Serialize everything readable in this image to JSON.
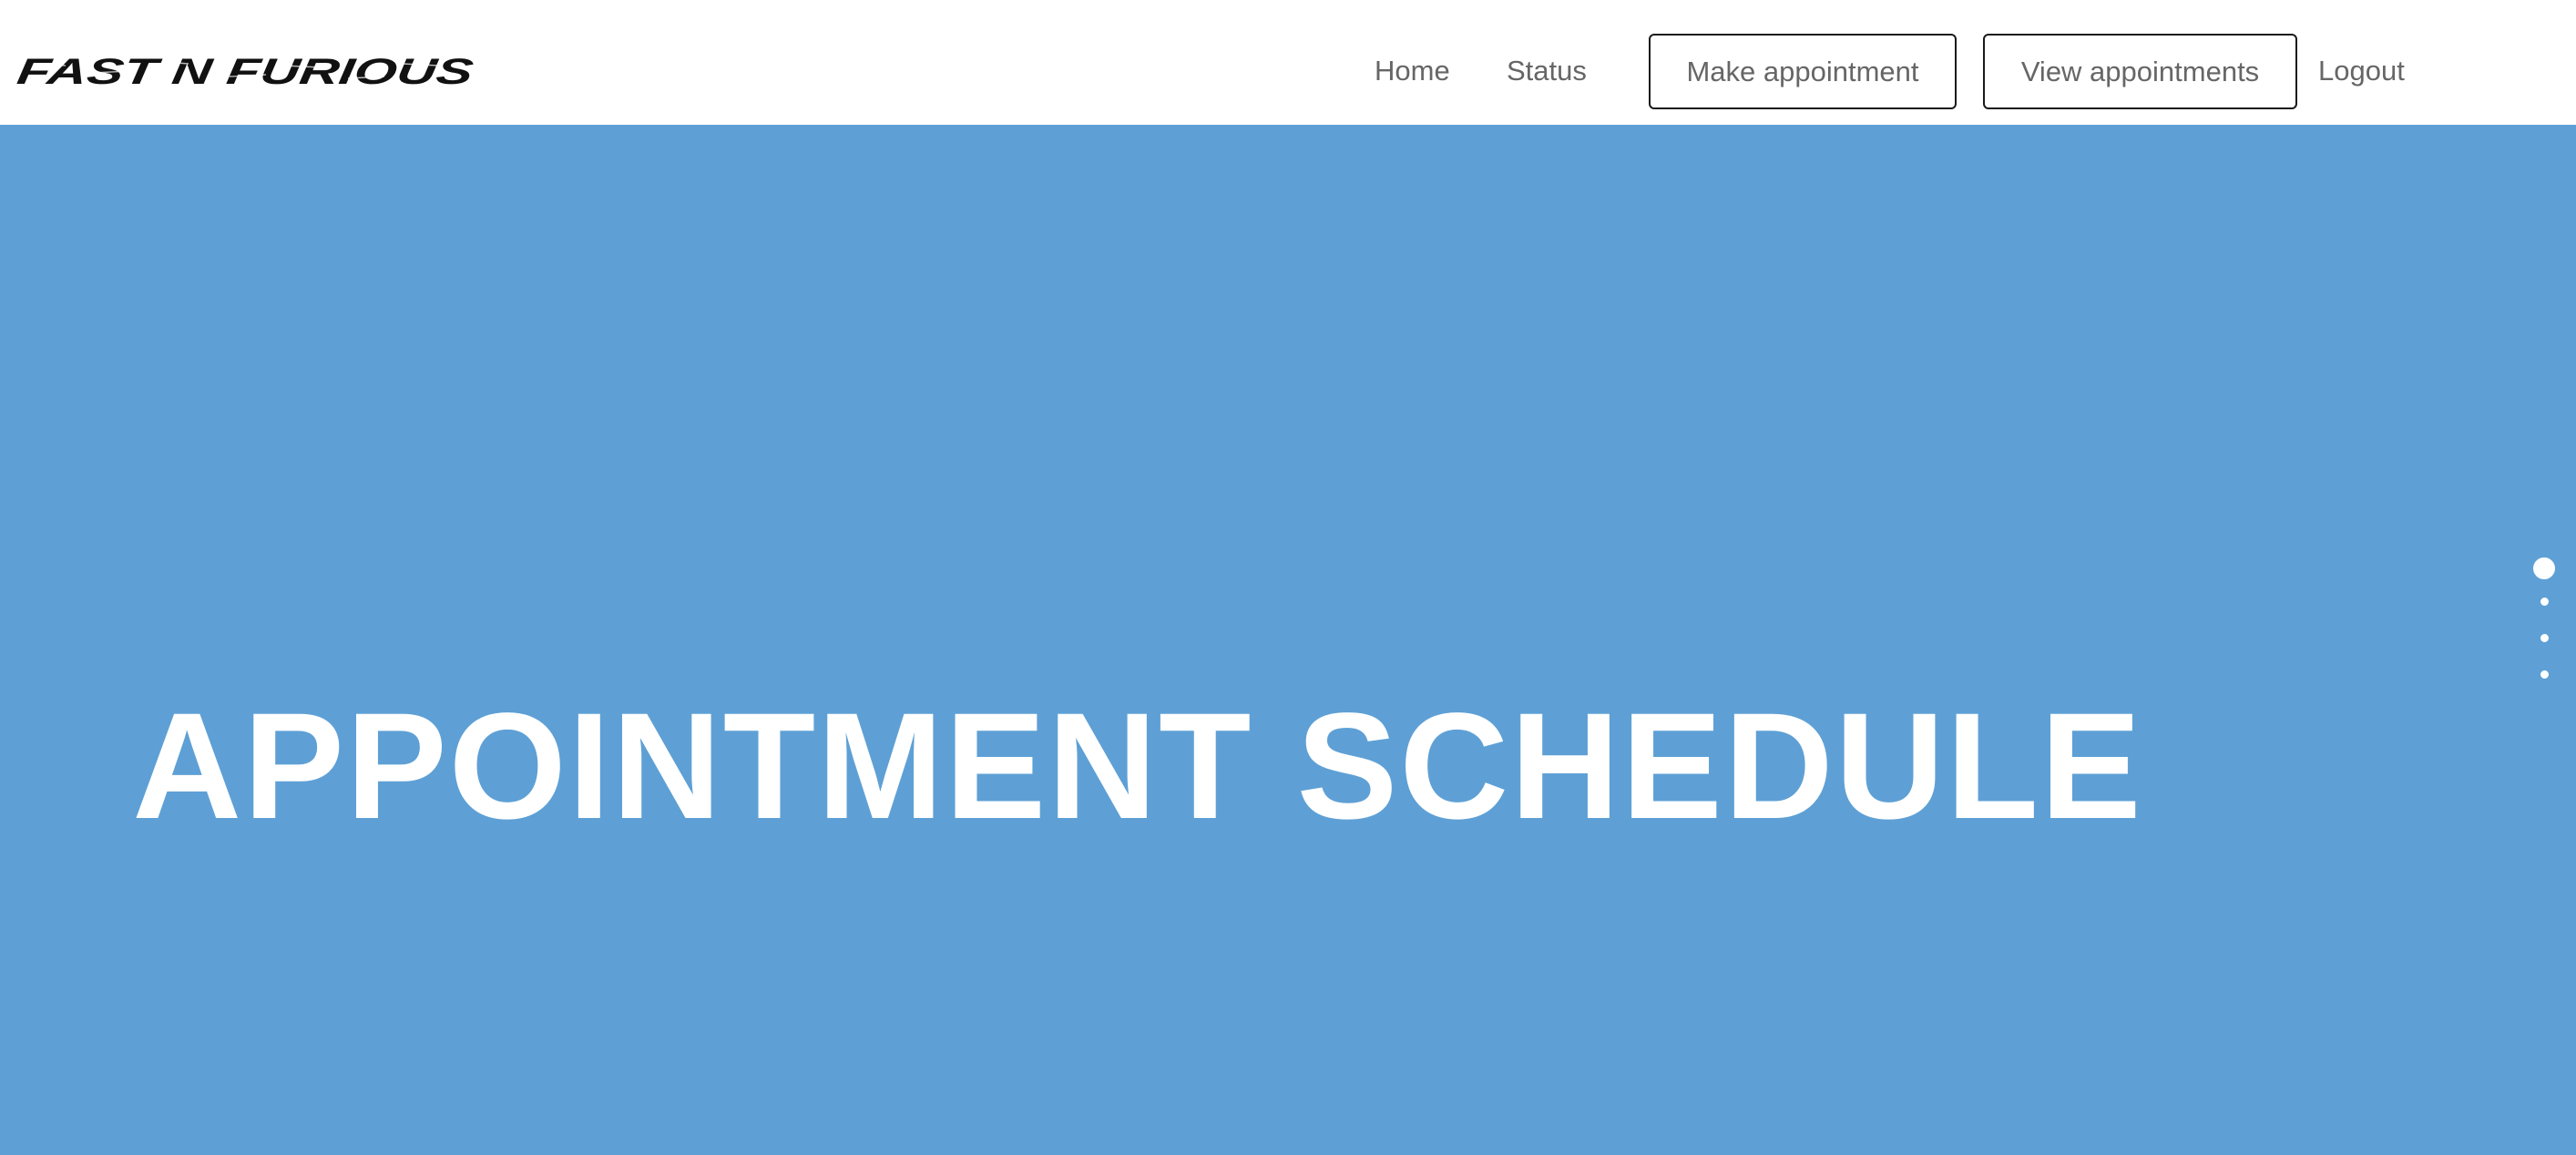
{
  "navbar": {
    "brand": "FAST N FURIOUS",
    "links": {
      "home": "Home",
      "status": "Status",
      "logout": "Logout"
    },
    "buttons": {
      "make_appointment": "Make appointment",
      "view_appointments": "View appointments"
    }
  },
  "hero": {
    "title": "APPOINTMENT SCHEDULE",
    "background_color": "#5ea0d5",
    "slides": {
      "count": 4,
      "active_index": 0
    }
  },
  "colors": {
    "nav_text": "#666666",
    "button_border": "#1a1a1a",
    "hero_text": "#ffffff"
  }
}
